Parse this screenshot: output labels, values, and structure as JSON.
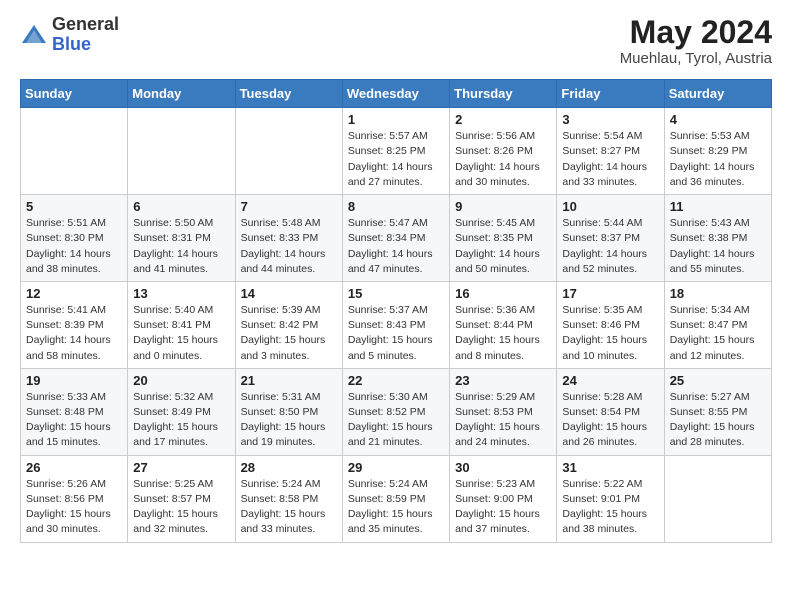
{
  "header": {
    "logo_general": "General",
    "logo_blue": "Blue",
    "month_year": "May 2024",
    "location": "Muehlau, Tyrol, Austria"
  },
  "days_of_week": [
    "Sunday",
    "Monday",
    "Tuesday",
    "Wednesday",
    "Thursday",
    "Friday",
    "Saturday"
  ],
  "weeks": [
    [
      {
        "day": "",
        "info": ""
      },
      {
        "day": "",
        "info": ""
      },
      {
        "day": "",
        "info": ""
      },
      {
        "day": "1",
        "info": "Sunrise: 5:57 AM\nSunset: 8:25 PM\nDaylight: 14 hours\nand 27 minutes."
      },
      {
        "day": "2",
        "info": "Sunrise: 5:56 AM\nSunset: 8:26 PM\nDaylight: 14 hours\nand 30 minutes."
      },
      {
        "day": "3",
        "info": "Sunrise: 5:54 AM\nSunset: 8:27 PM\nDaylight: 14 hours\nand 33 minutes."
      },
      {
        "day": "4",
        "info": "Sunrise: 5:53 AM\nSunset: 8:29 PM\nDaylight: 14 hours\nand 36 minutes."
      }
    ],
    [
      {
        "day": "5",
        "info": "Sunrise: 5:51 AM\nSunset: 8:30 PM\nDaylight: 14 hours\nand 38 minutes."
      },
      {
        "day": "6",
        "info": "Sunrise: 5:50 AM\nSunset: 8:31 PM\nDaylight: 14 hours\nand 41 minutes."
      },
      {
        "day": "7",
        "info": "Sunrise: 5:48 AM\nSunset: 8:33 PM\nDaylight: 14 hours\nand 44 minutes."
      },
      {
        "day": "8",
        "info": "Sunrise: 5:47 AM\nSunset: 8:34 PM\nDaylight: 14 hours\nand 47 minutes."
      },
      {
        "day": "9",
        "info": "Sunrise: 5:45 AM\nSunset: 8:35 PM\nDaylight: 14 hours\nand 50 minutes."
      },
      {
        "day": "10",
        "info": "Sunrise: 5:44 AM\nSunset: 8:37 PM\nDaylight: 14 hours\nand 52 minutes."
      },
      {
        "day": "11",
        "info": "Sunrise: 5:43 AM\nSunset: 8:38 PM\nDaylight: 14 hours\nand 55 minutes."
      }
    ],
    [
      {
        "day": "12",
        "info": "Sunrise: 5:41 AM\nSunset: 8:39 PM\nDaylight: 14 hours\nand 58 minutes."
      },
      {
        "day": "13",
        "info": "Sunrise: 5:40 AM\nSunset: 8:41 PM\nDaylight: 15 hours\nand 0 minutes."
      },
      {
        "day": "14",
        "info": "Sunrise: 5:39 AM\nSunset: 8:42 PM\nDaylight: 15 hours\nand 3 minutes."
      },
      {
        "day": "15",
        "info": "Sunrise: 5:37 AM\nSunset: 8:43 PM\nDaylight: 15 hours\nand 5 minutes."
      },
      {
        "day": "16",
        "info": "Sunrise: 5:36 AM\nSunset: 8:44 PM\nDaylight: 15 hours\nand 8 minutes."
      },
      {
        "day": "17",
        "info": "Sunrise: 5:35 AM\nSunset: 8:46 PM\nDaylight: 15 hours\nand 10 minutes."
      },
      {
        "day": "18",
        "info": "Sunrise: 5:34 AM\nSunset: 8:47 PM\nDaylight: 15 hours\nand 12 minutes."
      }
    ],
    [
      {
        "day": "19",
        "info": "Sunrise: 5:33 AM\nSunset: 8:48 PM\nDaylight: 15 hours\nand 15 minutes."
      },
      {
        "day": "20",
        "info": "Sunrise: 5:32 AM\nSunset: 8:49 PM\nDaylight: 15 hours\nand 17 minutes."
      },
      {
        "day": "21",
        "info": "Sunrise: 5:31 AM\nSunset: 8:50 PM\nDaylight: 15 hours\nand 19 minutes."
      },
      {
        "day": "22",
        "info": "Sunrise: 5:30 AM\nSunset: 8:52 PM\nDaylight: 15 hours\nand 21 minutes."
      },
      {
        "day": "23",
        "info": "Sunrise: 5:29 AM\nSunset: 8:53 PM\nDaylight: 15 hours\nand 24 minutes."
      },
      {
        "day": "24",
        "info": "Sunrise: 5:28 AM\nSunset: 8:54 PM\nDaylight: 15 hours\nand 26 minutes."
      },
      {
        "day": "25",
        "info": "Sunrise: 5:27 AM\nSunset: 8:55 PM\nDaylight: 15 hours\nand 28 minutes."
      }
    ],
    [
      {
        "day": "26",
        "info": "Sunrise: 5:26 AM\nSunset: 8:56 PM\nDaylight: 15 hours\nand 30 minutes."
      },
      {
        "day": "27",
        "info": "Sunrise: 5:25 AM\nSunset: 8:57 PM\nDaylight: 15 hours\nand 32 minutes."
      },
      {
        "day": "28",
        "info": "Sunrise: 5:24 AM\nSunset: 8:58 PM\nDaylight: 15 hours\nand 33 minutes."
      },
      {
        "day": "29",
        "info": "Sunrise: 5:24 AM\nSunset: 8:59 PM\nDaylight: 15 hours\nand 35 minutes."
      },
      {
        "day": "30",
        "info": "Sunrise: 5:23 AM\nSunset: 9:00 PM\nDaylight: 15 hours\nand 37 minutes."
      },
      {
        "day": "31",
        "info": "Sunrise: 5:22 AM\nSunset: 9:01 PM\nDaylight: 15 hours\nand 38 minutes."
      },
      {
        "day": "",
        "info": ""
      }
    ]
  ]
}
